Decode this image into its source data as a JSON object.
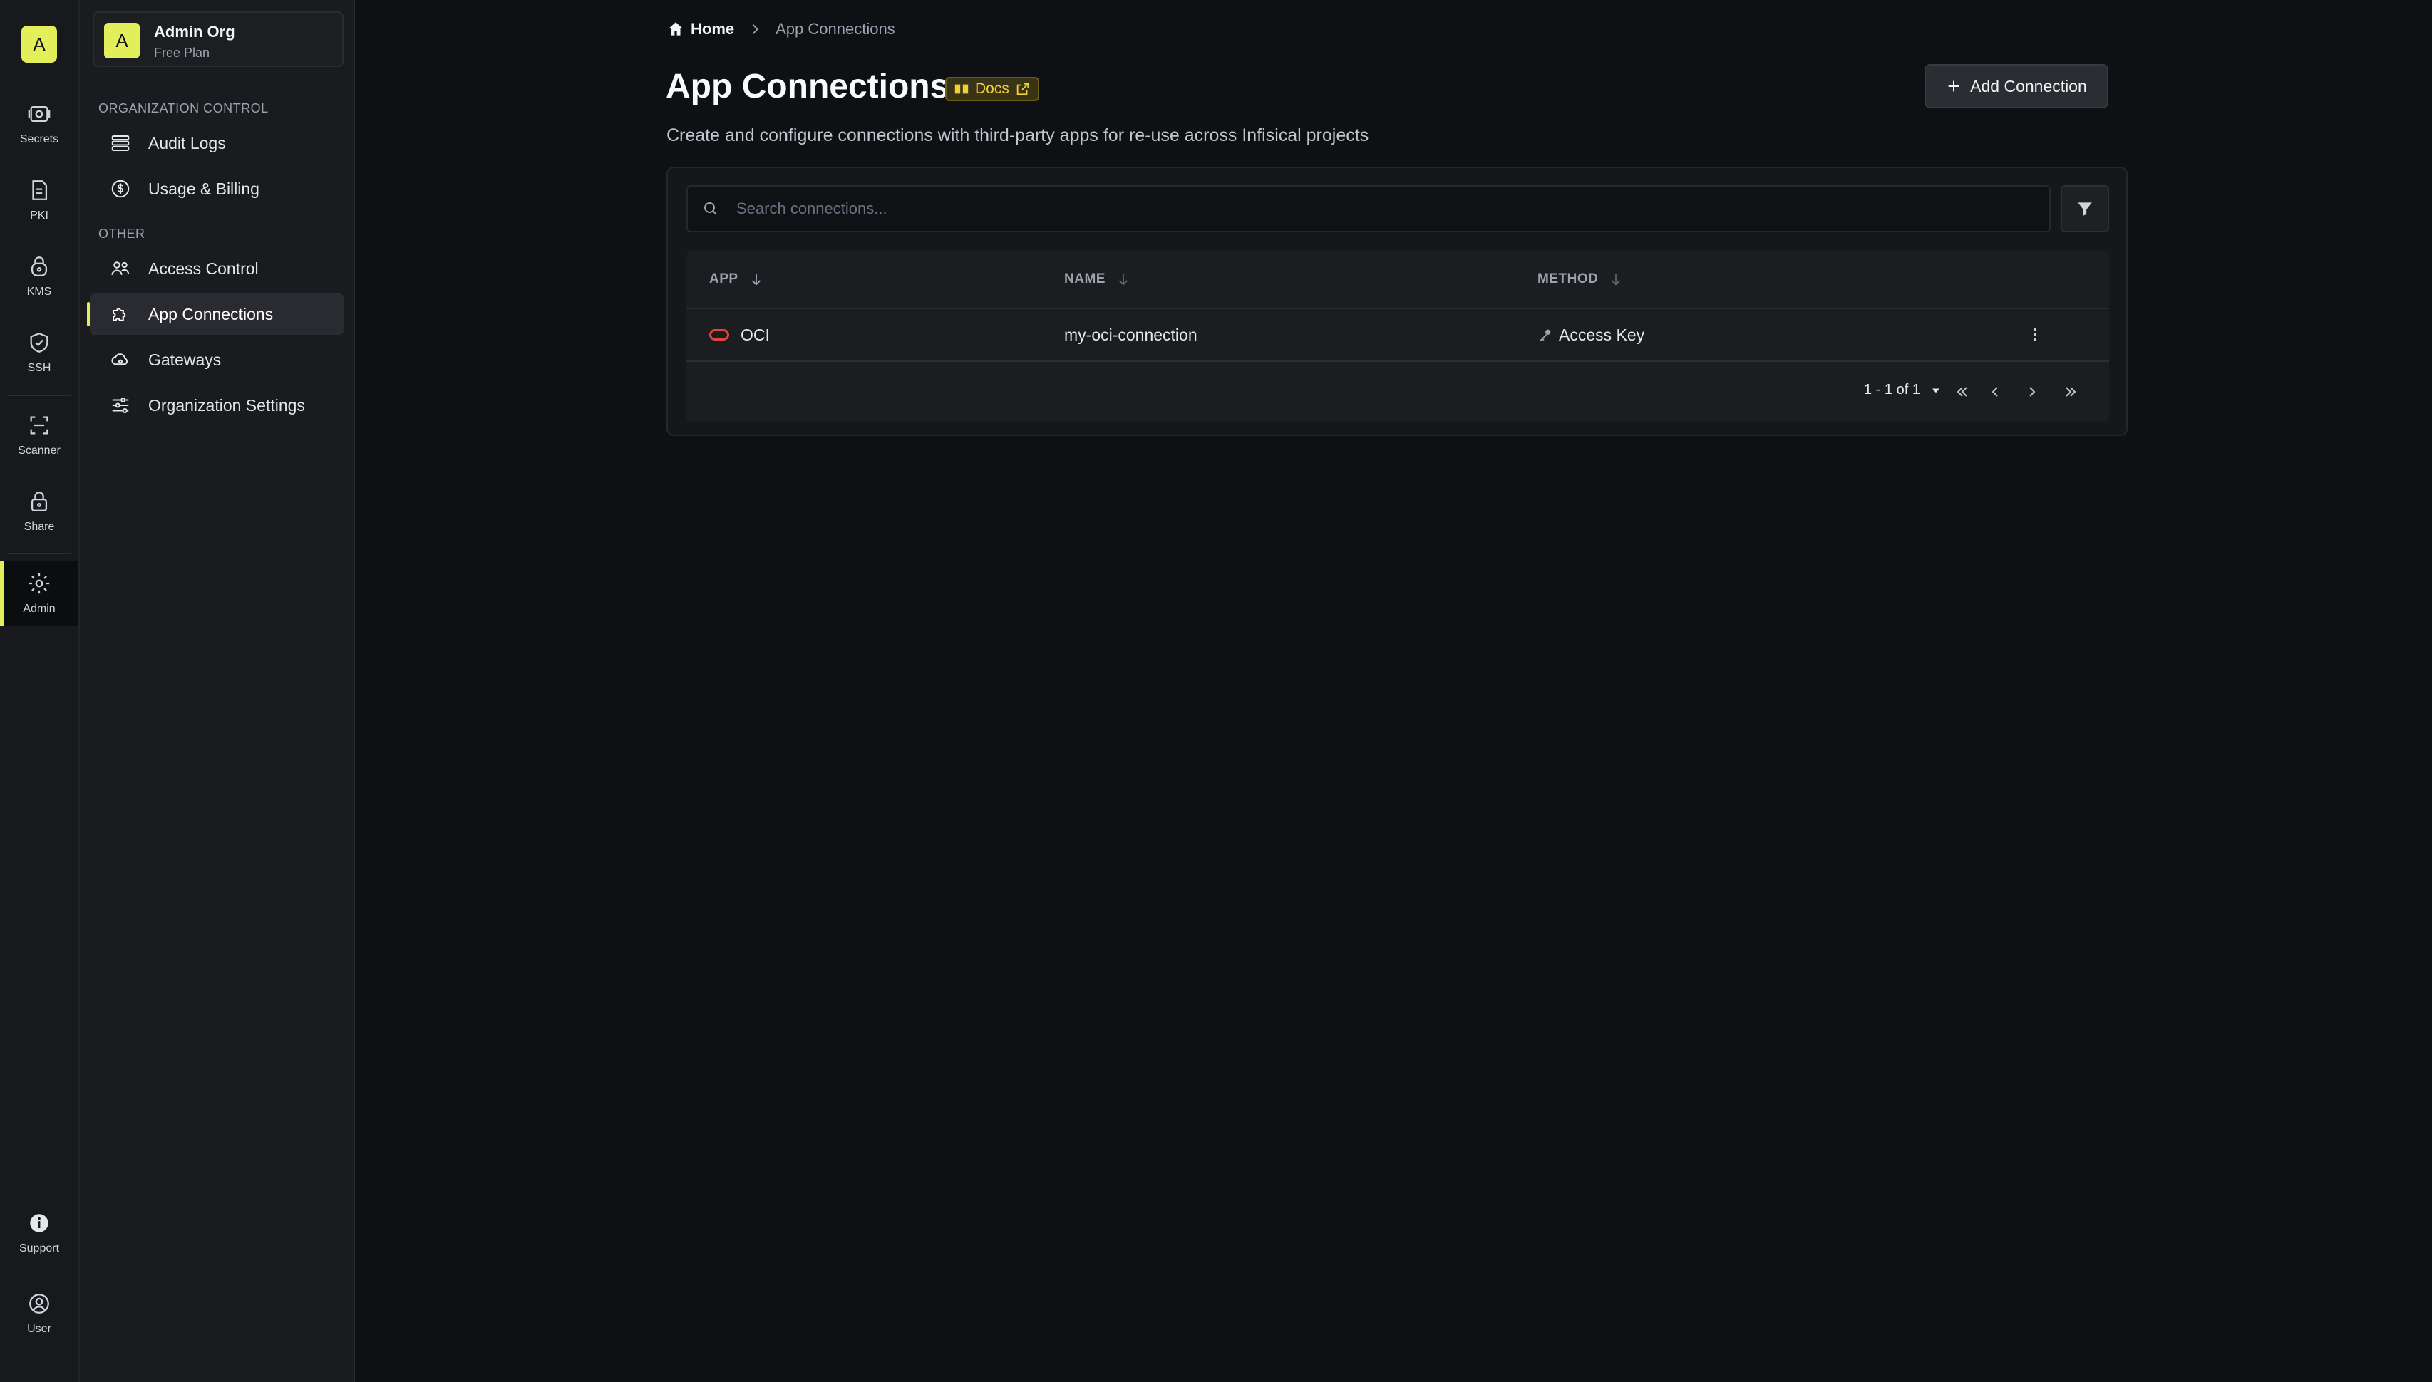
{
  "rail": {
    "logo_letter": "A",
    "items": [
      {
        "label": "Secrets",
        "icon": "vault-icon"
      },
      {
        "label": "PKI",
        "icon": "certificate-icon"
      },
      {
        "label": "KMS",
        "icon": "lock-key-icon"
      },
      {
        "label": "SSH",
        "icon": "shield-check-icon"
      },
      {
        "label": "Scanner",
        "icon": "scan-icon"
      },
      {
        "label": "Share",
        "icon": "lock-icon"
      },
      {
        "label": "Admin",
        "icon": "gear-icon",
        "active": true
      },
      {
        "label": "Support",
        "icon": "info-icon"
      },
      {
        "label": "User",
        "icon": "user-circle-icon"
      }
    ]
  },
  "org": {
    "avatar_letter": "A",
    "name": "Admin Org",
    "plan": "Free Plan"
  },
  "sidebar": {
    "section_org": "ORGANIZATION CONTROL",
    "section_other": "OTHER",
    "items": [
      {
        "label": "Audit Logs",
        "icon": "list-icon"
      },
      {
        "label": "Usage & Billing",
        "icon": "dollar-icon"
      },
      {
        "label": "Access Control",
        "icon": "users-icon"
      },
      {
        "label": "App Connections",
        "icon": "puzzle-icon",
        "active": true
      },
      {
        "label": "Gateways",
        "icon": "cloud-network-icon"
      },
      {
        "label": "Organization Settings",
        "icon": "sliders-icon"
      }
    ]
  },
  "breadcrumb": {
    "home": "Home",
    "current": "App Connections"
  },
  "header": {
    "title": "App Connections",
    "docs_label": "Docs",
    "add_button": "Add Connection",
    "description": "Create and configure connections with third-party apps for re-use across Infisical projects"
  },
  "search": {
    "placeholder": "Search connections..."
  },
  "table": {
    "columns": [
      "APP",
      "NAME",
      "METHOD"
    ],
    "rows": [
      {
        "app": "OCI",
        "name": "my-oci-connection",
        "method": "Access Key"
      }
    ],
    "pagination": "1 - 1 of 1"
  },
  "colors": {
    "accent": "#e2ef5a",
    "background": "#0f1014",
    "docs_badge": "#f2cf3a",
    "oci_logo": "#e0443c"
  }
}
